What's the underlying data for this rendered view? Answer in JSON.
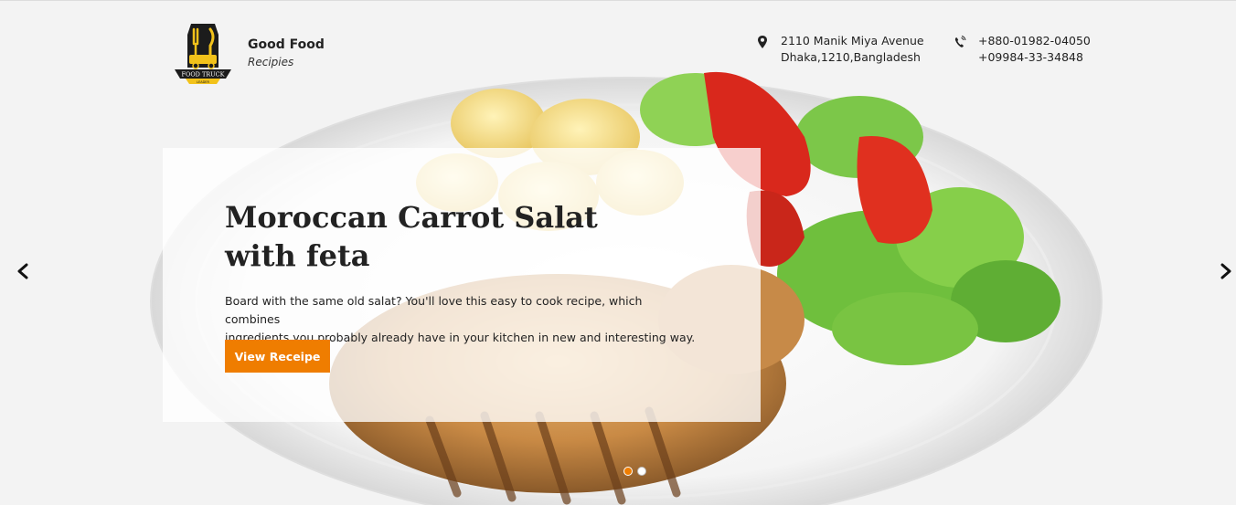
{
  "brand": {
    "name": "Good Food",
    "tagline": "Recipies",
    "logo_icon": "food-truck-logo",
    "logo_text": "FOOD TRUCK",
    "logo_subtext": "LEADER"
  },
  "contact": {
    "address_icon": "map-pin-icon",
    "address_line1": "2110 Manik Miya Avenue",
    "address_line2": "Dhaka,1210,Bangladesh",
    "phone_icon": "phone-icon",
    "phone_line1": "+880-01982-04050",
    "phone_line2": "+09984-33-34848"
  },
  "slide": {
    "title_line1": "Moroccan Carrot Salat",
    "title_line2": "with feta",
    "description_line1": "Board with the same old salat? You'll love this easy to cook recipe, which combines",
    "description_line2": "ingredients you probably already have in your kitchen in new and interesting way.",
    "cta_label": "View Receipe"
  },
  "slider": {
    "prev_icon": "chevron-left-icon",
    "next_icon": "chevron-right-icon",
    "slide_count": 2,
    "active_index": 0
  },
  "colors": {
    "accent": "#ef7d00",
    "background": "#f3f3f3",
    "text": "#222222"
  }
}
